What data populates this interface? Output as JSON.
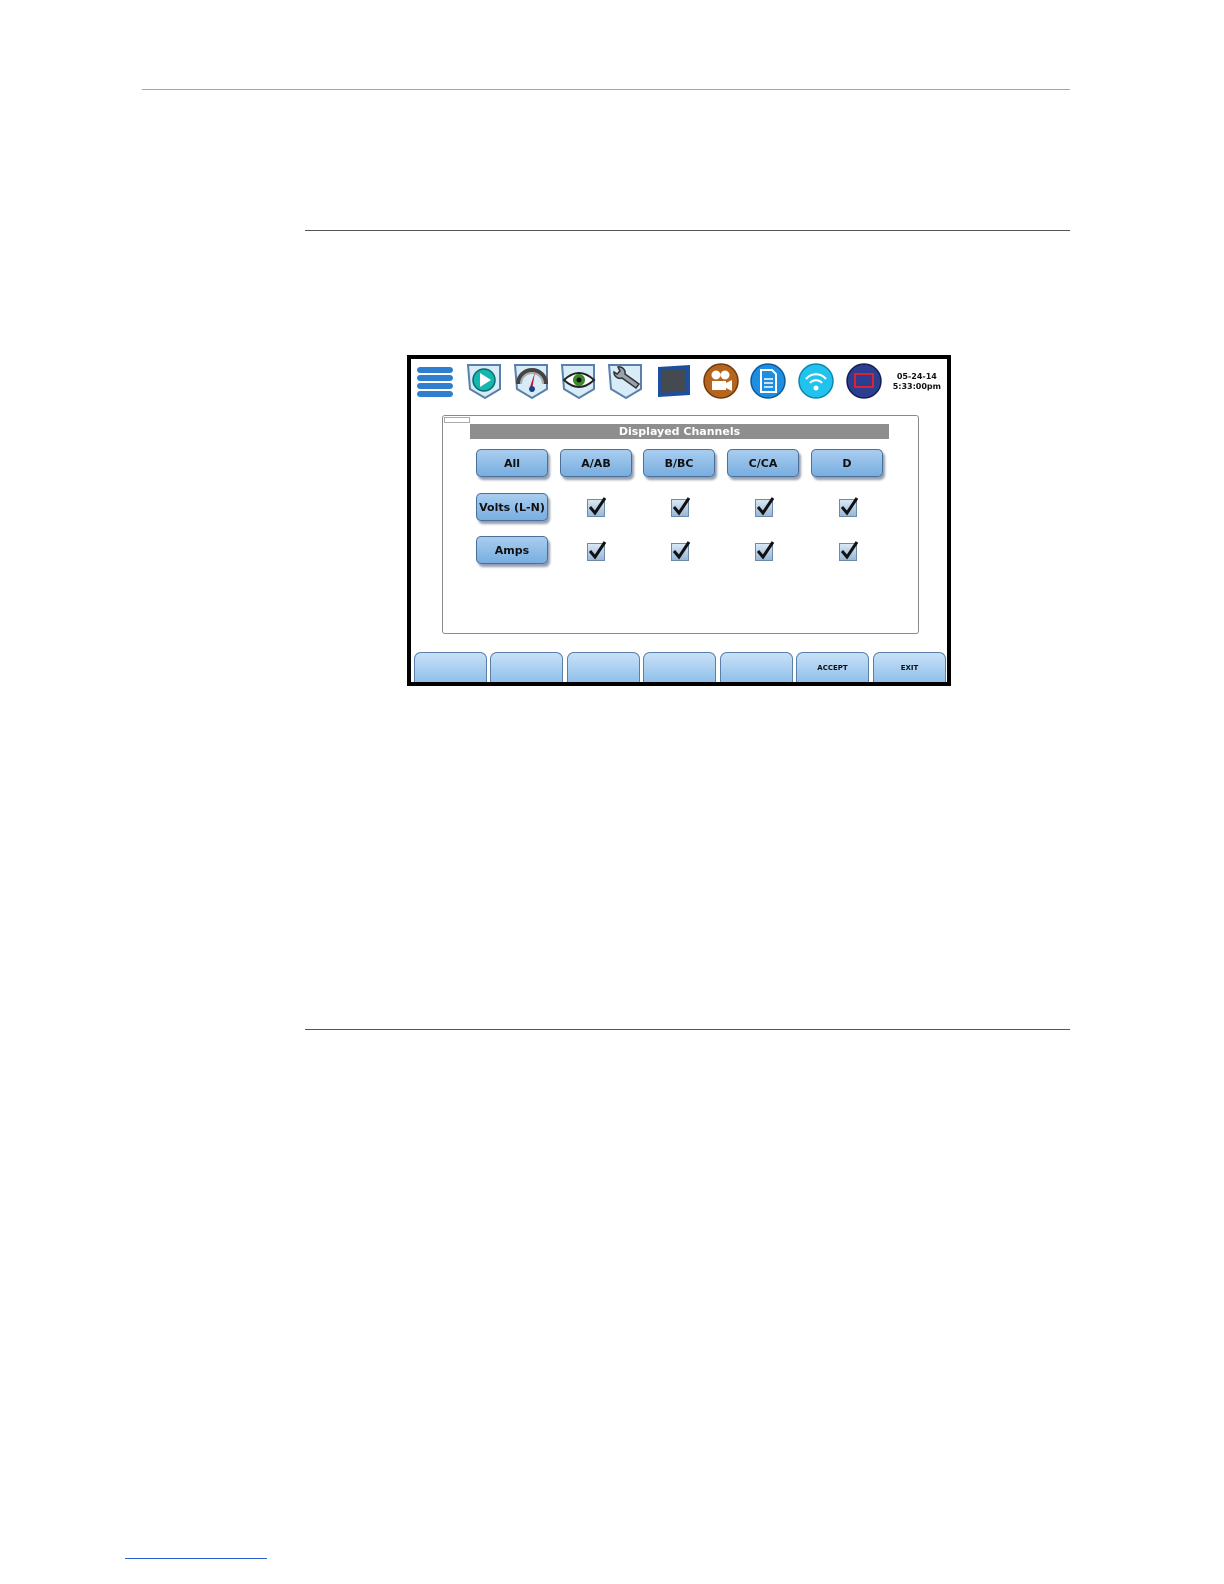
{
  "screen": {
    "toolbar": {
      "icons": [
        "menu-icon",
        "play-icon",
        "gauge-icon",
        "eye-icon",
        "wrench-icon",
        "monitor-icon",
        "camera-icon",
        "document-icon",
        "wireless-icon",
        "stop-icon"
      ],
      "date": "05-24-14",
      "time": "5:33:00pm"
    },
    "panel": {
      "title": "Displayed Channels",
      "columns": [
        "All",
        "A/AB",
        "B/BC",
        "C/CA",
        "D"
      ],
      "rows": [
        {
          "label": "Volts (L-N)",
          "checked": [
            true,
            true,
            true,
            true
          ]
        },
        {
          "label": "Amps",
          "checked": [
            true,
            true,
            true,
            true
          ]
        }
      ]
    },
    "softkeys": [
      "",
      "",
      "",
      "",
      "",
      "ACCEPT",
      "EXIT"
    ]
  },
  "colors": {
    "accent_rule": "#4fc3e8",
    "button": "#8fbce8",
    "panel_title": "#8e8e8e"
  }
}
